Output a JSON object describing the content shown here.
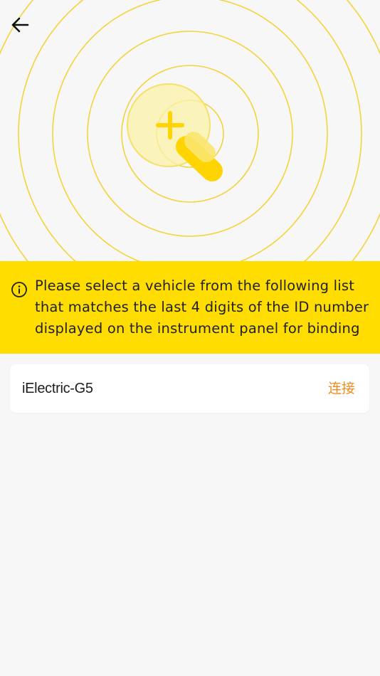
{
  "nav": {
    "back_icon": "arrow-left-icon"
  },
  "illustration": {
    "icon": "search-add-magnifier-icon",
    "ring_color": "#f5d33a",
    "accent_color": "#ffdd00"
  },
  "notice": {
    "icon": "info-circle-icon",
    "text": "Please select a vehicle from the following list that matches the last 4 digits of the ID number displayed on the instrument panel for binding",
    "background": "#ffdd00"
  },
  "devices": [
    {
      "name": "iElectric-G5",
      "action_label": "连接",
      "action_color": "#f08c1e"
    }
  ]
}
